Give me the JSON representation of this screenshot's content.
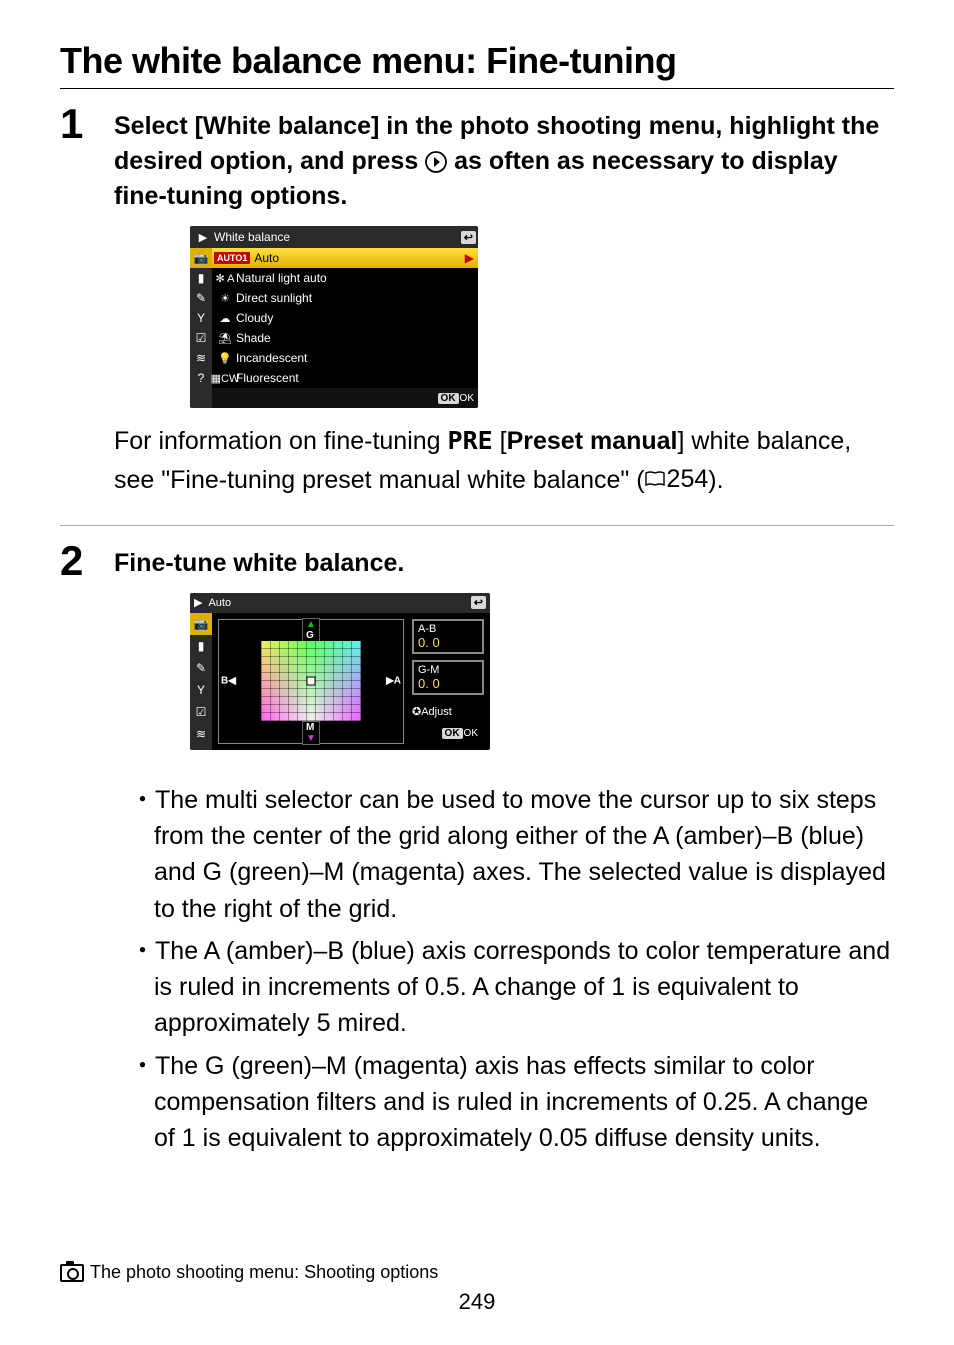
{
  "title": "The white balance menu: Fine-tuning",
  "steps": {
    "s1": {
      "num": "1",
      "heading_pre": "Select [White balance] in the photo shooting menu, highlight the desired option, and press ",
      "heading_post": " as often as necessary to display fine-tuning options.",
      "info_pre": "For information on fine-tuning ",
      "pre_label": "PRE",
      "info_mid": " [",
      "preset_manual": "Preset manual",
      "info_post1": "] white balance, see \"Fine-tuning preset manual white balance\" (",
      "pageref": "254",
      "info_post2": ")."
    },
    "s2": {
      "num": "2",
      "heading": "Fine-tune white balance."
    }
  },
  "menu": {
    "title": "White balance",
    "auto_badge": "AUTO1",
    "auto_label": "Auto",
    "items": [
      {
        "icon": "✻ A",
        "label": "Natural light auto"
      },
      {
        "icon": "☀",
        "label": "Direct sunlight"
      },
      {
        "icon": "☁",
        "label": "Cloudy"
      },
      {
        "icon": "⛱",
        "label": "Shade"
      },
      {
        "icon": "💡",
        "label": "Incandescent"
      },
      {
        "icon": "▦CW",
        "label": "Fluorescent"
      }
    ],
    "side_icons": [
      "▶",
      "📷",
      "▮",
      "✎",
      "Y",
      "☑",
      "≋",
      "?"
    ],
    "return": "↩",
    "ok": "OK",
    "ok_suffix": "OK"
  },
  "ft": {
    "title": "Auto",
    "g": "G",
    "m": "M",
    "b": "B◀",
    "a": "▶A",
    "ab_label": "A-B",
    "ab_val": "0. 0",
    "gm_label": "G-M",
    "gm_val": "0. 0",
    "adjust": "✪Adjust",
    "ok": "OK",
    "ok_suffix": "OK",
    "return": "↩",
    "side_icons": [
      "▶",
      "📷",
      "▮",
      "✎",
      "Y",
      "☑",
      "≋"
    ]
  },
  "bullets": [
    "The multi selector can be used to move the cursor up to six steps from the center of the grid along either of the A (amber)–B (blue) and G (green)–M (magenta) axes. The selected value is displayed to the right of the grid.",
    "The A (amber)–B (blue) axis corresponds to color temperature and is ruled in increments of 0.5. A change of 1 is equivalent to approximately 5 mired.",
    "The G (green)–M (magenta) axis has effects similar to color compensation filters and is ruled in increments of 0.25. A change of 1 is equivalent to approximately 0.05 diffuse density units."
  ],
  "footer": {
    "text": "The photo shooting menu: Shooting options",
    "page": "249"
  },
  "chart_data": {
    "type": "table",
    "title": "White balance fine-tuning grid readout",
    "axes": [
      {
        "name": "A-B",
        "range_steps": [
          -6,
          6
        ],
        "increment": 0.5,
        "unit": "≈5 mired per 1",
        "current": 0.0
      },
      {
        "name": "G-M",
        "range_steps": [
          -6,
          6
        ],
        "increment": 0.25,
        "unit": "≈0.05 diffuse density per 1",
        "current": 0.0
      }
    ]
  }
}
